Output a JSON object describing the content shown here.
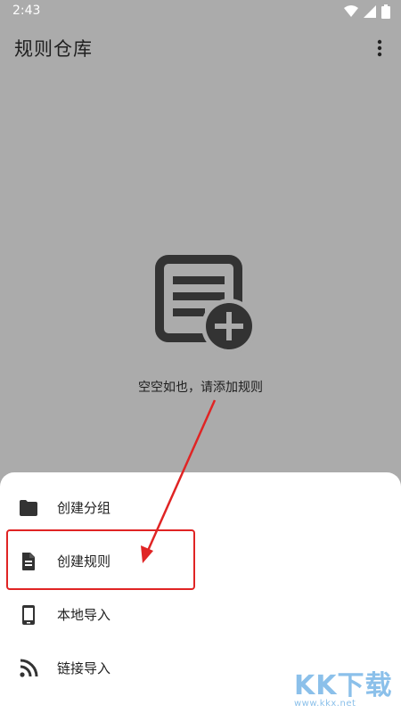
{
  "status_bar": {
    "time": "2:43"
  },
  "app_bar": {
    "title": "规则仓库"
  },
  "empty_state": {
    "message": "空空如也，请添加规则"
  },
  "sheet": {
    "items": [
      {
        "label": "创建分组",
        "icon": "folder-icon"
      },
      {
        "label": "创建规则",
        "icon": "document-icon"
      },
      {
        "label": "本地导入",
        "icon": "phone-icon"
      },
      {
        "label": "链接导入",
        "icon": "rss-icon"
      }
    ]
  },
  "watermark": {
    "logo": "KK下载",
    "url": "www.kkx.net"
  },
  "colors": {
    "highlight": "#e02424",
    "overlay": "#ababab",
    "icon": "#333333"
  }
}
